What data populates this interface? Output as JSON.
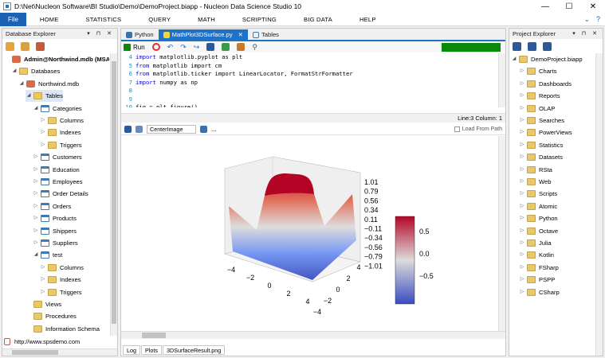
{
  "window": {
    "title": "D:\\Net\\Nucleon Software\\BI Studio\\Demo\\DemoProject.biapp - Nucleon Data Science Studio 10",
    "min": "—",
    "max": "☐",
    "close": "✕"
  },
  "menu": {
    "file": "File",
    "items": [
      "HOME",
      "STATISTICS",
      "QUERY",
      "MATH",
      "SCRIPTING",
      "BIG DATA",
      "HELP"
    ],
    "right": [
      "⌄",
      "?"
    ]
  },
  "db_explorer": {
    "title": "Database Explorer",
    "pin": "▾ ⊓ ✕",
    "tree": [
      {
        "label": "Admin@Northwind.mdb (MSAcces",
        "level": 0,
        "icon": "db",
        "tw": "",
        "bold": true
      },
      {
        "label": "Databases",
        "level": 1,
        "icon": "dbs",
        "tw": "◢"
      },
      {
        "label": "Northwind.mdb",
        "level": 2,
        "icon": "db",
        "tw": "◢"
      },
      {
        "label": "Tables",
        "level": 3,
        "icon": "folder",
        "tw": "◢",
        "sel": true
      },
      {
        "label": "Categories",
        "level": 4,
        "icon": "table",
        "tw": "◢"
      },
      {
        "label": "Columns",
        "level": 5,
        "icon": "folder",
        "tw": "▷"
      },
      {
        "label": "Indexes",
        "level": 5,
        "icon": "folder",
        "tw": "▷"
      },
      {
        "label": "Triggers",
        "level": 5,
        "icon": "folder",
        "tw": "▷"
      },
      {
        "label": "Customers",
        "level": 4,
        "icon": "table",
        "tw": "▷"
      },
      {
        "label": "Education",
        "level": 4,
        "icon": "table",
        "tw": "▷"
      },
      {
        "label": "Employees",
        "level": 4,
        "icon": "table",
        "tw": "▷"
      },
      {
        "label": "Order Details",
        "level": 4,
        "icon": "table",
        "tw": "▷"
      },
      {
        "label": "Orders",
        "level": 4,
        "icon": "table",
        "tw": "▷"
      },
      {
        "label": "Products",
        "level": 4,
        "icon": "table",
        "tw": "▷"
      },
      {
        "label": "Shippers",
        "level": 4,
        "icon": "table",
        "tw": "▷"
      },
      {
        "label": "Suppliers",
        "level": 4,
        "icon": "table",
        "tw": "▷"
      },
      {
        "label": "test",
        "level": 4,
        "icon": "table",
        "tw": "◢"
      },
      {
        "label": "Columns",
        "level": 5,
        "icon": "folder",
        "tw": "▷"
      },
      {
        "label": "Indexes",
        "level": 5,
        "icon": "folder",
        "tw": "▷"
      },
      {
        "label": "Triggers",
        "level": 5,
        "icon": "folder",
        "tw": "▷"
      },
      {
        "label": "Views",
        "level": 3,
        "icon": "folder",
        "tw": ""
      },
      {
        "label": "Procedures",
        "level": 3,
        "icon": "folder",
        "tw": ""
      },
      {
        "label": "Information Schema",
        "level": 3,
        "icon": "folder",
        "tw": ""
      }
    ],
    "url": "http://www.spsdemo.com"
  },
  "editor": {
    "tabs": [
      {
        "label": "Python",
        "active": false
      },
      {
        "label": "MathPlot3DSurface.py",
        "active": true
      },
      {
        "label": "Tables",
        "active": false
      }
    ],
    "run_label": "Run",
    "code": [
      {
        "n": "4",
        "kw": "import",
        "rest": " matplotlib.pyplot as plt"
      },
      {
        "n": "5",
        "kw": "from",
        "rest": " matplotlib import cm"
      },
      {
        "n": "6",
        "kw": "from",
        "rest": " matplotlib.ticker import LinearLocator, FormatStrFormatter"
      },
      {
        "n": "7",
        "kw": "import",
        "rest": " numpy as np"
      },
      {
        "n": "8",
        "kw": "",
        "rest": ""
      },
      {
        "n": "9",
        "kw": "",
        "rest": ""
      },
      {
        "n": "10",
        "kw": "",
        "rest": "fig = plt.figure()"
      },
      {
        "n": "11",
        "kw": "",
        "rest": "ax = fig.gca(projection='3d')"
      }
    ],
    "status": "Line:3 Column: 1"
  },
  "image_viewer": {
    "mode": "CenterImage",
    "load_label": "Load From Path",
    "ellipsis": "..."
  },
  "plot": {
    "colorbar_ticks": [
      "0.5",
      "0.0",
      "−0.5"
    ],
    "z_ticks": [
      "1.01",
      "0.79",
      "0.56",
      "0.34",
      "0.11",
      "−0.11",
      "−0.34",
      "−0.56",
      "−0.79",
      "−1.01"
    ],
    "x_ticks": [
      "−4",
      "−2",
      "0",
      "2",
      "4"
    ],
    "y_ticks": [
      "4",
      "2",
      "0",
      "−2",
      "−4"
    ]
  },
  "bottom_tabs": [
    "Log",
    "Plots",
    "3DSurfaceResult.png"
  ],
  "project_explorer": {
    "title": "Project Explorer",
    "pin": "▾ ⊓ ✕",
    "root": "DemoProject.biapp",
    "items": [
      "Charts",
      "Dashboards",
      "Reports",
      "OLAP",
      "Searches",
      "PowerViews",
      "Statistics",
      "Datasets",
      "RSta",
      "Web",
      "Scripts",
      "Atomic",
      "Python",
      "Octave",
      "Julia",
      "Kotlin",
      "FSharp",
      "PSPP",
      "CSharp"
    ]
  },
  "colors": {
    "accent": "#1e73c8",
    "file": "#1b62b3",
    "progress": "#0a8a0a"
  }
}
